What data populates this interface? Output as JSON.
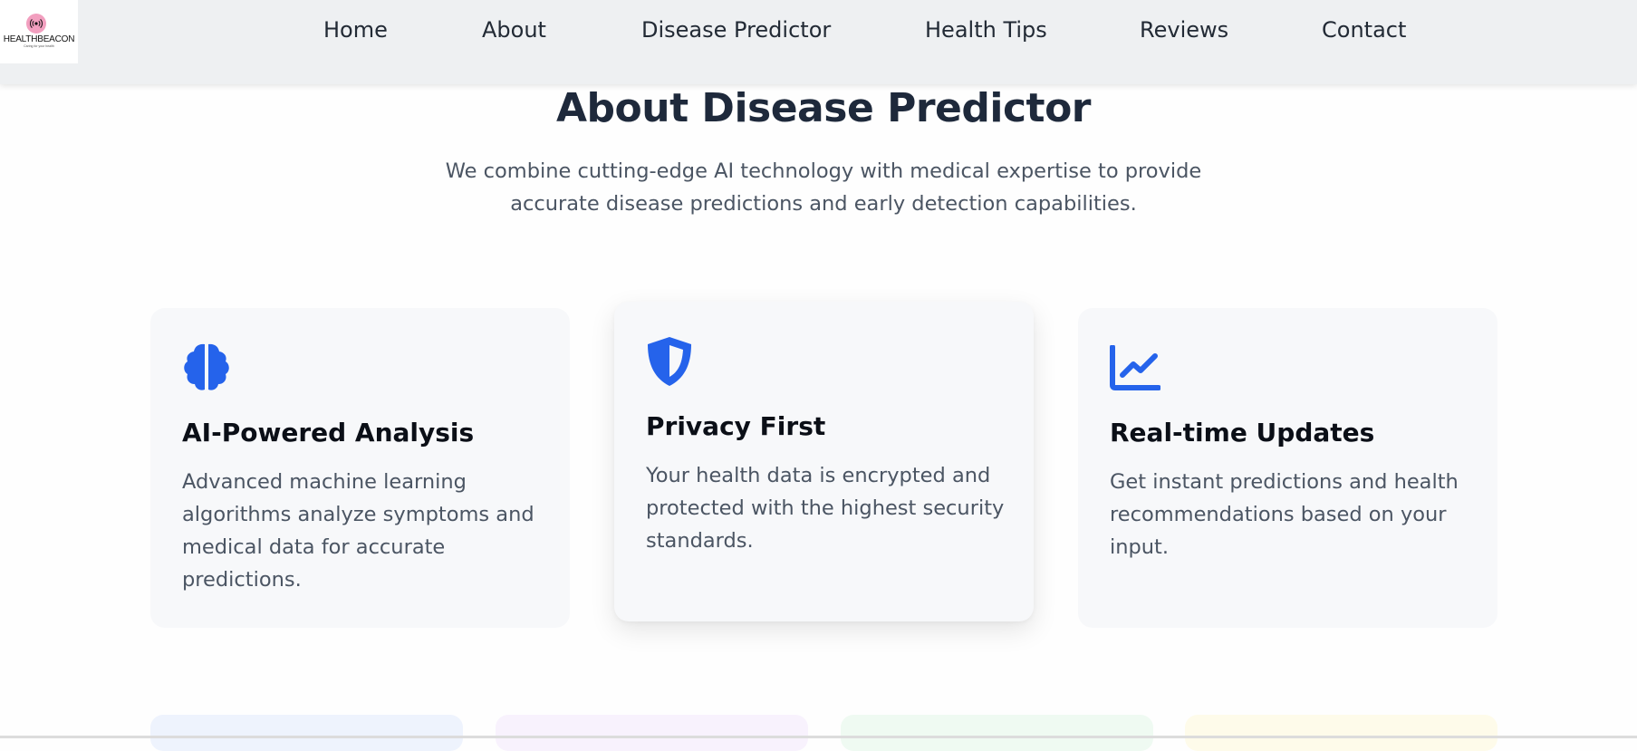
{
  "brand": {
    "name": "HEALTHBEACON",
    "tagline": "Caring for your health"
  },
  "nav": {
    "items": [
      {
        "label": "Home"
      },
      {
        "label": "About"
      },
      {
        "label": "Disease Predictor"
      },
      {
        "label": "Health Tips"
      },
      {
        "label": "Reviews"
      },
      {
        "label": "Contact"
      }
    ]
  },
  "about": {
    "title": "About Disease Predictor",
    "subtitle_line1": "We combine cutting-edge AI technology with medical expertise to provide",
    "subtitle_line2": "accurate disease predictions and early detection capabilities."
  },
  "features": [
    {
      "icon": "brain-icon",
      "title": "AI-Powered Analysis",
      "text": "Advanced machine learning algorithms analyze symptoms and medical data for accurate predictions."
    },
    {
      "icon": "shield-icon",
      "title": "Privacy First",
      "text": "Your health data is encrypted and protected with the highest security standards."
    },
    {
      "icon": "chart-line-icon",
      "title": "Real-time Updates",
      "text": "Get instant predictions and health recommendations based on your input."
    }
  ],
  "colors": {
    "accent": "#2563eb",
    "header_bg": "#eef0f2",
    "card_bg": "#f7f8fa",
    "peek_cards": [
      "#eef3fd",
      "#f8f2fd",
      "#effaf2",
      "#fefbea"
    ]
  }
}
